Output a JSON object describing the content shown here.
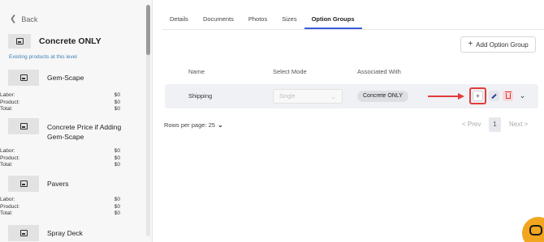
{
  "sidebar": {
    "back_label": "Back",
    "product_title": "Concrete ONLY",
    "caption": "Existing products at this level",
    "products": [
      {
        "name": "Gem-Scape",
        "labor_label": "Labor:",
        "labor": "$0",
        "product_label": "Product:",
        "product": "$0",
        "total_label": "Total:",
        "total": "$0"
      },
      {
        "name": "Concrete Price if Adding Gem-Scape",
        "labor_label": "Labor:",
        "labor": "$0",
        "product_label": "Product:",
        "product": "$0",
        "total_label": "Total:",
        "total": "$0"
      },
      {
        "name": "Pavers",
        "labor_label": "Labor:",
        "labor": "$0",
        "product_label": "Product:",
        "product": "$0",
        "total_label": "Total:",
        "total": "$0"
      },
      {
        "name": "Spray Deck"
      }
    ]
  },
  "tabs": [
    {
      "label": "Details"
    },
    {
      "label": "Documents"
    },
    {
      "label": "Photos"
    },
    {
      "label": "Sizes"
    },
    {
      "label": "Option Groups",
      "active": true
    }
  ],
  "toolbar": {
    "add_group_label": "Add Option Group"
  },
  "table": {
    "columns": [
      "Name",
      "Select Mode",
      "Associated With"
    ],
    "rows": [
      {
        "name": "Shipping",
        "select_mode": "Single",
        "associated_with": "Concrete ONLY"
      }
    ]
  },
  "pagination": {
    "rows_per_page_label": "Rows per page: 25",
    "prev_label": "< Prev",
    "current_page": "1",
    "next_label": "Next >"
  },
  "colors": {
    "accent": "#3b5bdb",
    "highlight": "#e23b3b",
    "chat": "#f2a51f"
  }
}
